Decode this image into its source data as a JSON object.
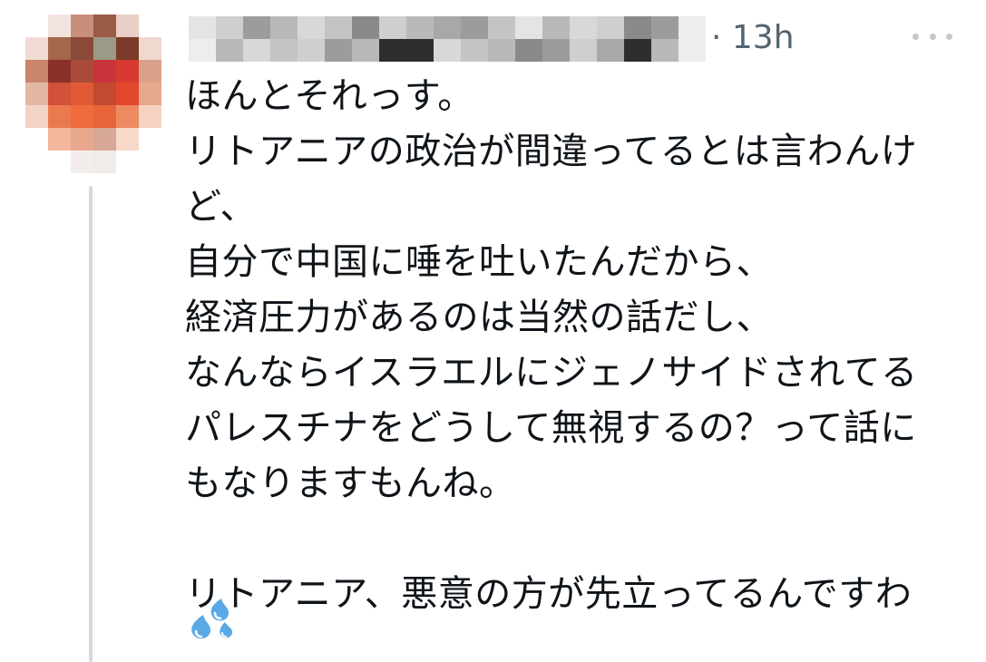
{
  "tweet": {
    "timestamp": "13h",
    "more_label": "More",
    "lines": [
      "ほんとそれっす。",
      "リトアニアの政治が間違ってるとは言わんけ",
      "ど、",
      "自分で中国に唾を吐いたんだから、",
      "経済圧力があるのは当然の話だし、",
      "なんならイスラエルにジェノサイドされてる",
      "パレスチナをどうして無視するの？って話に",
      "もなりますもんね。",
      "",
      "リトアニア、悪意の方が先立ってるんですわ"
    ],
    "emoji": "sweat-droplets"
  },
  "colors": {
    "text": "#0f1419",
    "secondary": "#536471",
    "thread_line": "#cfd9de",
    "emoji_blue": "#5aa9e6"
  }
}
